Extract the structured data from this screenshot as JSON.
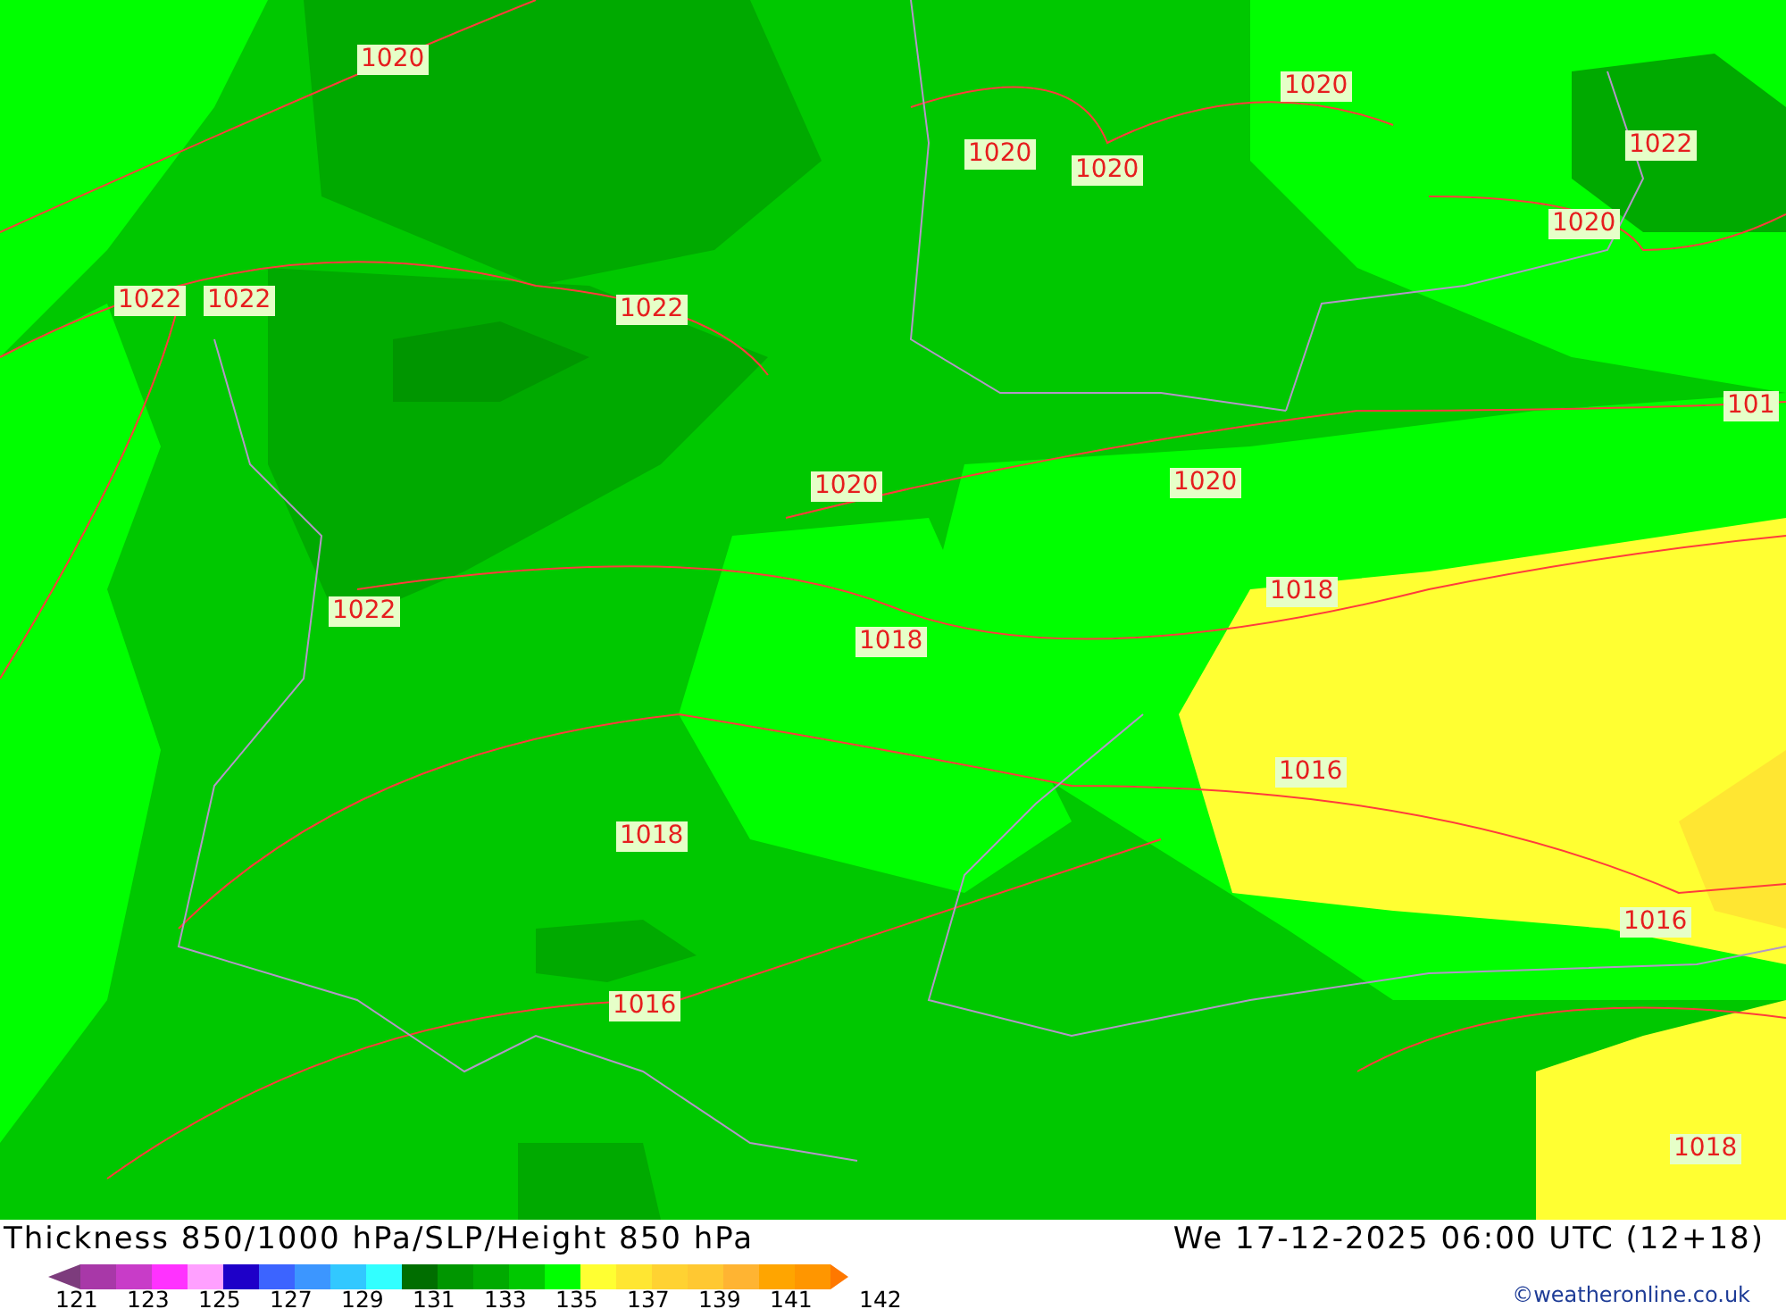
{
  "map": {
    "isobar_labels": [
      "1020",
      "1020",
      "1020",
      "1020",
      "1022",
      "1020",
      "1022",
      "1022",
      "1022",
      "101",
      "1020",
      "1020",
      "1018",
      "1022",
      "1018",
      "1016",
      "1018",
      "1016",
      "1016",
      "1018"
    ]
  },
  "footer": {
    "title": "Thickness 850/1000 hPa/SLP/Height 850 hPa",
    "valid_time": "We 17-12-2025 06:00 UTC (12+18)",
    "credit": "©weatheronline.co.uk"
  },
  "legend": {
    "segments": [
      {
        "color": "#a838a8"
      },
      {
        "color": "#c83cc8"
      },
      {
        "color": "#ff32ff"
      },
      {
        "color": "#ffa0ff"
      },
      {
        "color": "#1e00c8"
      },
      {
        "color": "#3c64ff"
      },
      {
        "color": "#3c96ff"
      },
      {
        "color": "#32c8ff"
      },
      {
        "color": "#32ffff"
      },
      {
        "color": "#006e00"
      },
      {
        "color": "#009600"
      },
      {
        "color": "#00aa00"
      },
      {
        "color": "#00c800"
      },
      {
        "color": "#00ff00"
      },
      {
        "color": "#ffff32"
      },
      {
        "color": "#ffe632"
      },
      {
        "color": "#ffd232"
      },
      {
        "color": "#ffc832"
      },
      {
        "color": "#ffb432"
      },
      {
        "color": "#ffa500"
      },
      {
        "color": "#ff9600"
      }
    ],
    "labels": [
      "121",
      "123",
      "125",
      "127",
      "129",
      "131",
      "133",
      "135",
      "137",
      "139",
      "141",
      "142"
    ]
  }
}
